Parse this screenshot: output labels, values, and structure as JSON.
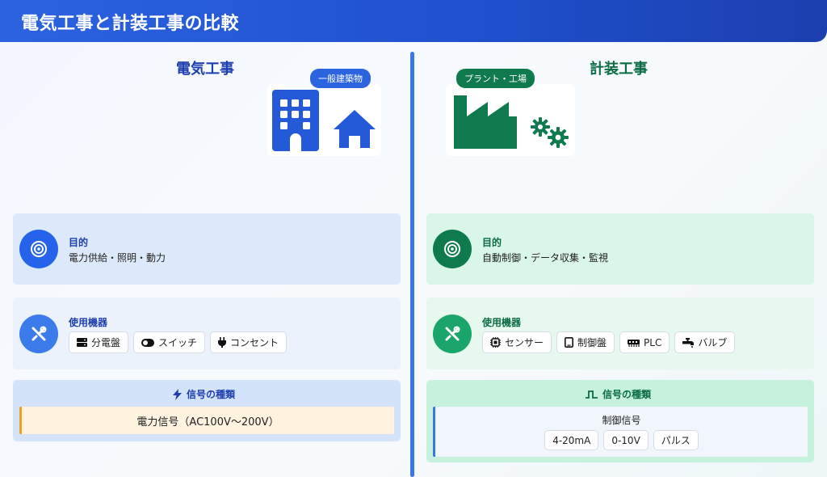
{
  "header": {
    "title": "電気工事と計装工事の比較"
  },
  "left": {
    "title": "電気工事",
    "tag": "一般建築物",
    "purpose": {
      "label": "目的",
      "text": "電力供給・照明・動力"
    },
    "equipment": {
      "label": "使用機器",
      "items": [
        {
          "label": "分電盤",
          "icon": "panel-icon"
        },
        {
          "label": "スイッチ",
          "icon": "toggle-icon"
        },
        {
          "label": "コンセント",
          "icon": "plug-icon"
        }
      ]
    },
    "signal": {
      "label": "信号の種類",
      "value": "電力信号（AC100V〜200V）"
    }
  },
  "right": {
    "title": "計装工事",
    "tag": "プラント・工場",
    "purpose": {
      "label": "目的",
      "text": "自動制御・データ収集・監視"
    },
    "equipment": {
      "label": "使用機器",
      "items": [
        {
          "label": "センサー",
          "icon": "chip-icon"
        },
        {
          "label": "制御盤",
          "icon": "tablet-icon"
        },
        {
          "label": "PLC",
          "icon": "memory-icon"
        },
        {
          "label": "バルブ",
          "icon": "faucet-icon"
        }
      ]
    },
    "signal": {
      "label": "信号の種類",
      "sub": "制御信号",
      "values": [
        "4-20mA",
        "0-10V",
        "パルス"
      ]
    }
  },
  "colors": {
    "blue": "#2563eb",
    "darkblue": "#1e40af",
    "green": "#0e7a4e",
    "darkgreen": "#0b6b44",
    "orange": "#f0a020"
  }
}
